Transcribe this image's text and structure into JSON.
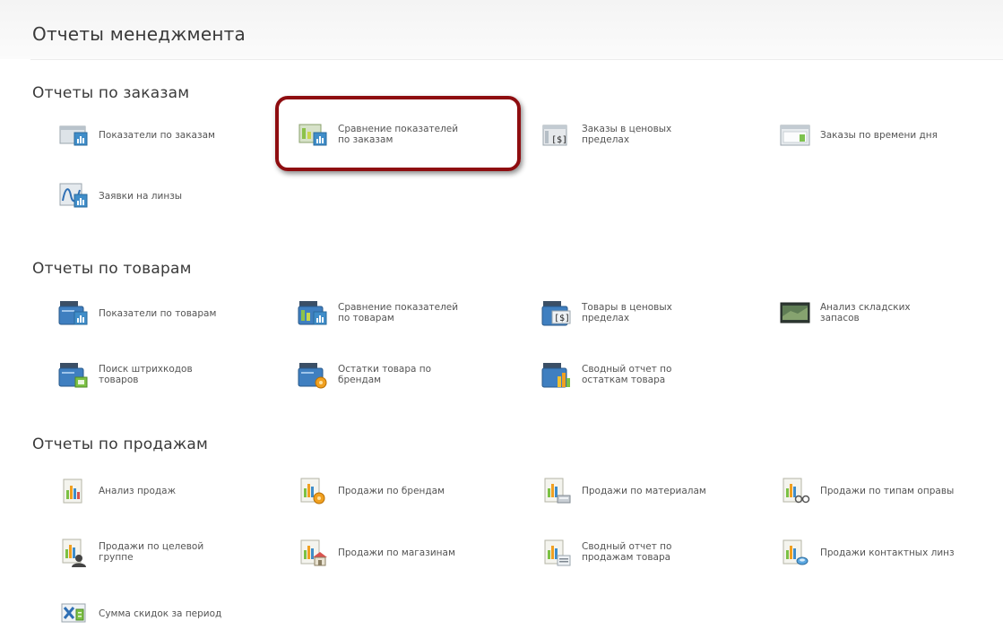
{
  "page": {
    "title": "Отчеты менеджмента"
  },
  "sections": {
    "orders": {
      "title": "Отчеты по заказам",
      "items": [
        {
          "label": "Показатели по заказам",
          "icon": "order-stats-icon"
        },
        {
          "label": "Сравнение показателей\nпо заказам",
          "icon": "order-compare-icon"
        },
        {
          "label": "Заказы в ценовых\nпределах",
          "icon": "price-range-icon"
        },
        {
          "label": "Заказы по времени дня",
          "icon": "time-of-day-icon"
        },
        {
          "label": "Заявки на линзы",
          "icon": "lens-requests-icon"
        }
      ]
    },
    "products": {
      "title": "Отчеты по товарам",
      "items": [
        {
          "label": "Показатели по товарам",
          "icon": "product-stats-icon"
        },
        {
          "label": "Сравнение показателей\nпо товарам",
          "icon": "product-compare-icon"
        },
        {
          "label": "Товары в ценовых\nпределах",
          "icon": "product-price-range-icon"
        },
        {
          "label": "Анализ складских\nзапасов",
          "icon": "stock-analysis-icon"
        },
        {
          "label": "Поиск штрихкодов\nтоваров",
          "icon": "barcode-search-icon"
        },
        {
          "label": "Остатки товара по\nбрендам",
          "icon": "stock-by-brand-icon"
        },
        {
          "label": "Сводный отчет по\nостаткам товара",
          "icon": "stock-summary-icon"
        }
      ]
    },
    "sales": {
      "title": "Отчеты по продажам",
      "items": [
        {
          "label": "Анализ продаж",
          "icon": "sales-analysis-icon"
        },
        {
          "label": "Продажи по брендам",
          "icon": "sales-by-brand-icon"
        },
        {
          "label": "Продажи по материалам",
          "icon": "sales-by-material-icon"
        },
        {
          "label": "Продажи по типам оправы",
          "icon": "sales-by-frame-type-icon"
        },
        {
          "label": "Продажи по целевой\nгруппе",
          "icon": "sales-by-target-group-icon"
        },
        {
          "label": "Продажи по магазинам",
          "icon": "sales-by-store-icon"
        },
        {
          "label": "Сводный отчет по\nпродажам товара",
          "icon": "sales-summary-icon"
        },
        {
          "label": "Продажи контактных линз",
          "icon": "contact-lens-sales-icon"
        },
        {
          "label": "Сумма скидок за период",
          "icon": "discount-total-icon"
        }
      ]
    }
  }
}
